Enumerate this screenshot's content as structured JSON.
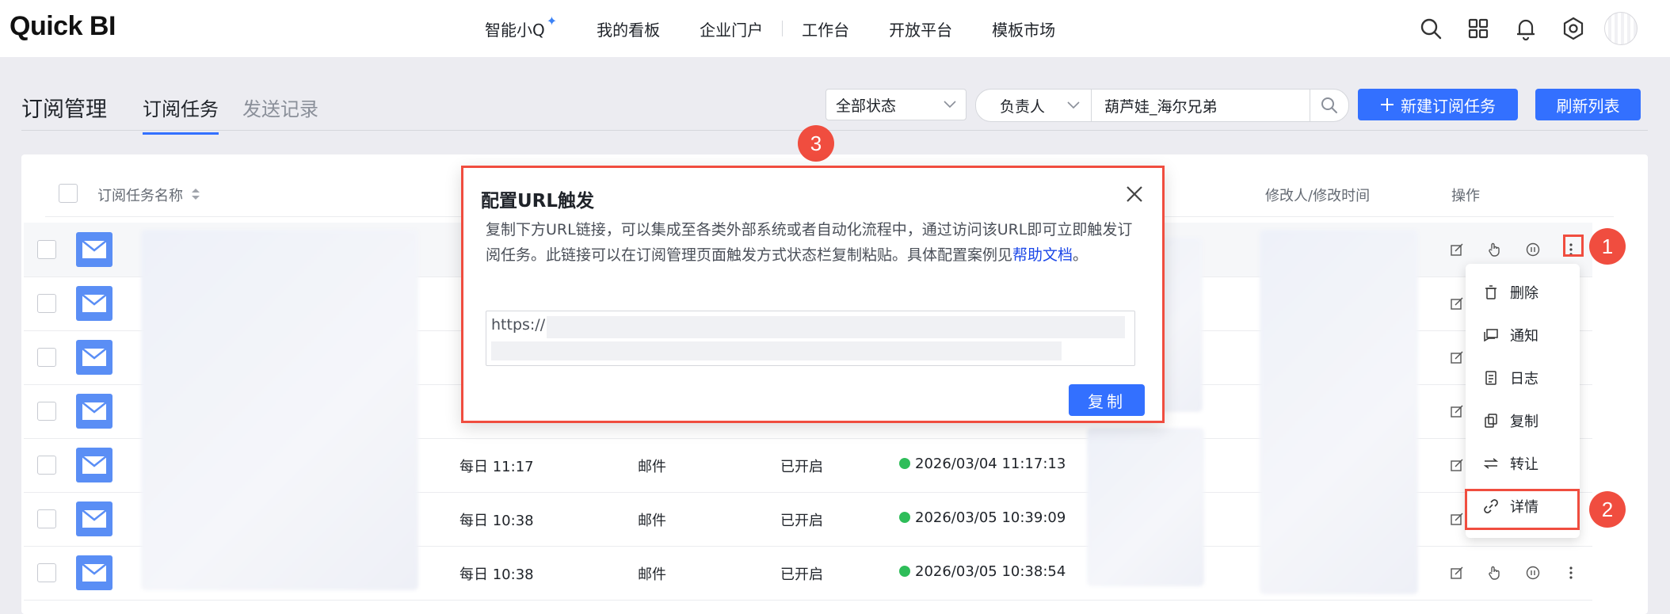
{
  "nav": {
    "logo": "Quick BI",
    "items": [
      {
        "label": "智能小Q"
      },
      {
        "label": "我的看板"
      },
      {
        "label": "企业门户"
      },
      {
        "label": "工作台"
      },
      {
        "label": "开放平台"
      },
      {
        "label": "模板市场"
      }
    ],
    "icons": [
      "search-icon",
      "grid-icon",
      "bell-icon",
      "gear-icon",
      "avatar"
    ]
  },
  "page": {
    "title": "订阅管理",
    "tabs": [
      {
        "label": "订阅任务",
        "active": true
      },
      {
        "label": "发送记录",
        "active": false
      }
    ]
  },
  "filters": {
    "status": "全部状态",
    "owner_label": "负责人",
    "owner_value": "葫芦娃_海尔兄弟",
    "new_button": "新建订阅任务",
    "refresh_button": "刷新列表"
  },
  "table": {
    "columns": {
      "name": "订阅任务名称",
      "modifier": "修改人/修改时间",
      "actions": "操作"
    },
    "rows": [
      {
        "schedule": "",
        "channel": "",
        "state": "",
        "last_run": ""
      },
      {
        "schedule": "",
        "channel": "",
        "state": "",
        "last_run": ""
      },
      {
        "schedule": "",
        "channel": "",
        "state": "",
        "last_run": ""
      },
      {
        "schedule": "",
        "channel": "",
        "state": "",
        "last_run": ""
      },
      {
        "schedule": "每日 11:17",
        "channel": "邮件",
        "state": "已开启",
        "last_run": "2026/03/04 11:17:13"
      },
      {
        "schedule": "每日 10:38",
        "channel": "邮件",
        "state": "已开启",
        "last_run": "2026/03/05 10:39:09"
      },
      {
        "schedule": "每日 10:38",
        "channel": "邮件",
        "state": "已开启",
        "last_run": "2026/03/05 10:38:54"
      }
    ]
  },
  "menu": {
    "items": [
      {
        "label": "删除",
        "icon": "trash-icon"
      },
      {
        "label": "通知",
        "icon": "notify-icon"
      },
      {
        "label": "日志",
        "icon": "log-icon"
      },
      {
        "label": "复制",
        "icon": "copy-icon"
      },
      {
        "label": "转让",
        "icon": "transfer-icon"
      },
      {
        "label": "详情",
        "icon": "link-icon"
      }
    ]
  },
  "modal": {
    "title": "配置URL触发",
    "desc_main": "复制下方URL链接，可以集成至各类外部系统或者自动化流程中，通过访问该URL即可立即触发订阅任务。此链接可以在订阅管理页面触发方式状态栏复制粘贴。具体配置案例见",
    "help_link": "帮助文档",
    "desc_end": "。",
    "url_prefix": "https://",
    "copy_button": "复制"
  },
  "badges": {
    "one": "1",
    "two": "2",
    "three": "3"
  },
  "colors": {
    "primary": "#3370ff",
    "annotation": "#f04d3f",
    "mail_icon": "#5a8ef5",
    "status_ok": "#2ebd59"
  }
}
